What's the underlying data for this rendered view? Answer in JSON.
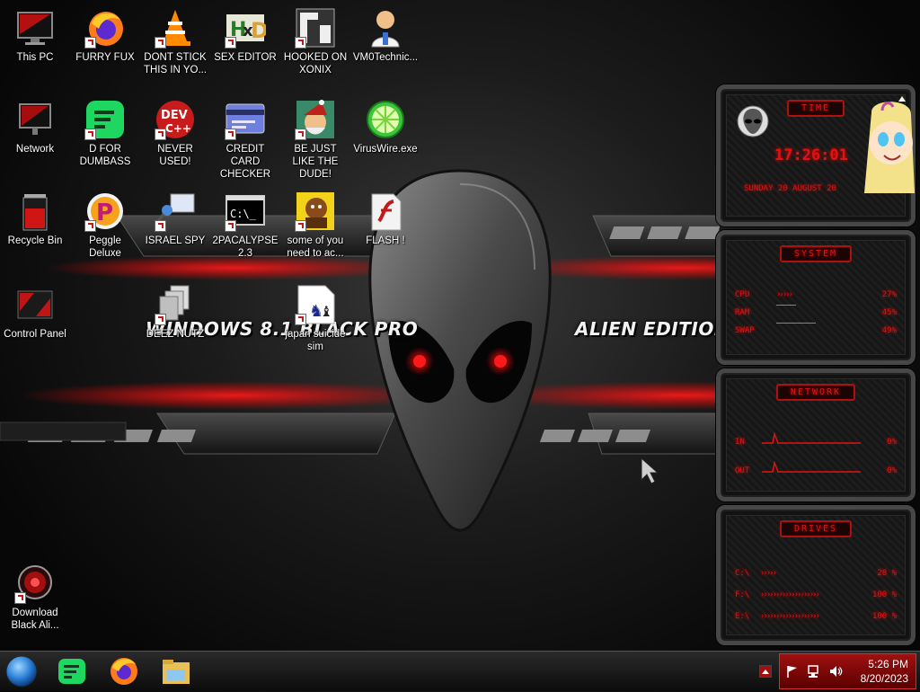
{
  "wallpaper": {
    "left_text": "WINDOWS 8.1 BLACK PRO",
    "right_text": "ALIEN EDITION 20"
  },
  "desktop_icons": [
    {
      "label": "This PC",
      "icon": "monitor-icon"
    },
    {
      "label": "FURRY FUX",
      "icon": "firefox-icon"
    },
    {
      "label": "DONT STICK THIS IN YO...",
      "icon": "vlc-cone-icon"
    },
    {
      "label": "SEX EDITOR",
      "icon": "hex-editor-icon"
    },
    {
      "label": "HOOKED ON XONIX",
      "icon": "xonix-game-icon"
    },
    {
      "label": "VM0Technic...",
      "icon": "doctor-avatar-icon"
    },
    {
      "label": "Network",
      "icon": "network-icon"
    },
    {
      "label": "D FOR DUMBASS",
      "icon": "green-chat-icon"
    },
    {
      "label": "NEVER USED!",
      "icon": "dev-cpp-icon"
    },
    {
      "label": "CREDIT CARD CHECKER",
      "icon": "credit-card-icon"
    },
    {
      "label": "BE JUST LIKE THE DUDE!",
      "icon": "elf-santa-icon"
    },
    {
      "label": "VirusWire.exe",
      "icon": "lime-icon"
    },
    {
      "label": "Recycle Bin",
      "icon": "recycle-bin-icon"
    },
    {
      "label": "Peggle Deluxe",
      "icon": "peggle-icon"
    },
    {
      "label": "ISRAEL SPY",
      "icon": "spy-glass-icon"
    },
    {
      "label": "2PACALYPSE 2.3",
      "icon": "terminal-icon"
    },
    {
      "label": "some of you need to ac...",
      "icon": "beaver-icon"
    },
    {
      "label": "FLASH !",
      "icon": "flash-file-icon"
    },
    {
      "label": "Control Panel",
      "icon": "control-panel-icon"
    },
    {
      "label": "DEEZ NUTZ",
      "icon": "stacked-windows-icon"
    },
    {
      "label": "japan suicide sim",
      "icon": "chess-pieces-icon"
    },
    {
      "label": "Download Black Ali...",
      "icon": "alien-orb-icon"
    }
  ],
  "gadgets": {
    "time": {
      "title": "TIME",
      "clock": "17:26:01",
      "date": "SUNDAY 20 AUGUST 20"
    },
    "system": {
      "title": "SYSTEM",
      "rows": [
        {
          "label": "CPU",
          "value": "27%"
        },
        {
          "label": "RAM",
          "value": "45%"
        },
        {
          "label": "SWAP",
          "value": "49%"
        }
      ]
    },
    "network": {
      "title": "NETWORK",
      "rows": [
        {
          "label": "IN",
          "value": "0%"
        },
        {
          "label": "OUT",
          "value": "0%"
        }
      ]
    },
    "drives": {
      "title": "DRIVES",
      "rows": [
        {
          "label": "C:\\",
          "value": "28 %"
        },
        {
          "label": "F:\\",
          "value": "100 %"
        },
        {
          "label": "E:\\",
          "value": "100 %"
        }
      ]
    }
  },
  "taskbar": {
    "pinned": [
      "start-orb-icon",
      "green-chat-icon",
      "firefox-icon",
      "file-explorer-icon"
    ],
    "clock_time": "5:26 PM",
    "clock_date": "8/20/2023",
    "colors": {
      "accent": "#b01010",
      "tray": "#8a0b0b"
    }
  }
}
